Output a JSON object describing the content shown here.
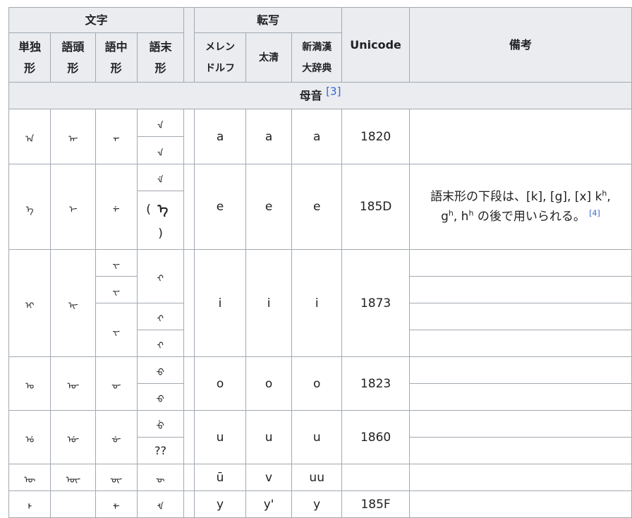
{
  "headers": {
    "moji": "文字",
    "tensha": "転写",
    "unicode": "Unicode",
    "biko": "備考",
    "tandoku": [
      "単独",
      "形"
    ],
    "goto": [
      "語頭",
      "形"
    ],
    "gochu": [
      "語中",
      "形"
    ],
    "gomatsu": [
      "語末",
      "形"
    ],
    "mellendorff": [
      "メレン",
      "ドルフ"
    ],
    "taishin": "太清",
    "shinmankan": [
      "新満漢",
      "大辞典"
    ]
  },
  "section": {
    "title": "母音",
    "ref": "[3]"
  },
  "rows": {
    "a": {
      "tandoku": "ᠠ",
      "goto": "ᠠ᠊",
      "gochu": "᠊ᠠ᠊",
      "gomatsu": [
        "᠊ᠠ",
        "᠊ᠠ"
      ],
      "mel": "a",
      "tai": "a",
      "shin": "a",
      "uni": "1820"
    },
    "e": {
      "tandoku": "ᡝ",
      "goto": "ᡝ᠊",
      "gochu": "᠊ᡝ᠊",
      "gomatsu": [
        "᠊ᡝ",
        "(",
        "ᡝ",
        ")"
      ],
      "mel": "e",
      "tai": "e",
      "shin": "e",
      "uni": "185D",
      "note_a": "語末形の下段は、[k], [g], [x] k",
      "note_sup1": "h",
      "note_b": ",",
      "note_c": "g",
      "note_sup2": "h",
      "note_d": ", h",
      "note_sup3": "h",
      "note_e": " の後で用いられる。",
      "note_ref": "[4]"
    },
    "i": {
      "tandoku": "ᡳ",
      "goto": "ᡳ᠊",
      "gochu": [
        "᠊ᡳ᠊",
        "᠊ᡳ᠊",
        "᠊ᡳ᠊"
      ],
      "gomatsu": [
        "᠊ᡳ",
        "᠊ᡳ",
        "᠊ᡳ"
      ],
      "mel": "i",
      "tai": "i",
      "shin": "i",
      "uni": "1873"
    },
    "o": {
      "tandoku": "ᠣ",
      "goto": "ᠣ᠊",
      "gochu": "᠊ᠣ᠊",
      "gomatsu": [
        "᠊ᠣ",
        "᠊ᠣ"
      ],
      "mel": "o",
      "tai": "o",
      "shin": "o",
      "uni": "1823"
    },
    "u": {
      "tandoku": "ᡠ",
      "goto": "ᡠ᠊",
      "gochu": "᠊ᡠ᠊",
      "gomatsu": [
        "᠊ᡠ",
        "??"
      ],
      "mel": "u",
      "tai": "u",
      "shin": "u",
      "uni": "1860"
    },
    "uu": {
      "tandoku": "ᡡ",
      "goto": "ᡡ᠊",
      "gochu": "᠊ᡡ᠊",
      "gomatsu": "᠊ᡡ",
      "mel": "ū",
      "tai": "v",
      "shin": "uu",
      "uni": ""
    },
    "y": {
      "tandoku": "ᡟ",
      "goto": "",
      "gochu": "᠊ᡟ᠊",
      "gomatsu": "᠊ᡟ",
      "mel": "y",
      "tai": "y'",
      "shin": "y",
      "uni": "185F"
    }
  }
}
